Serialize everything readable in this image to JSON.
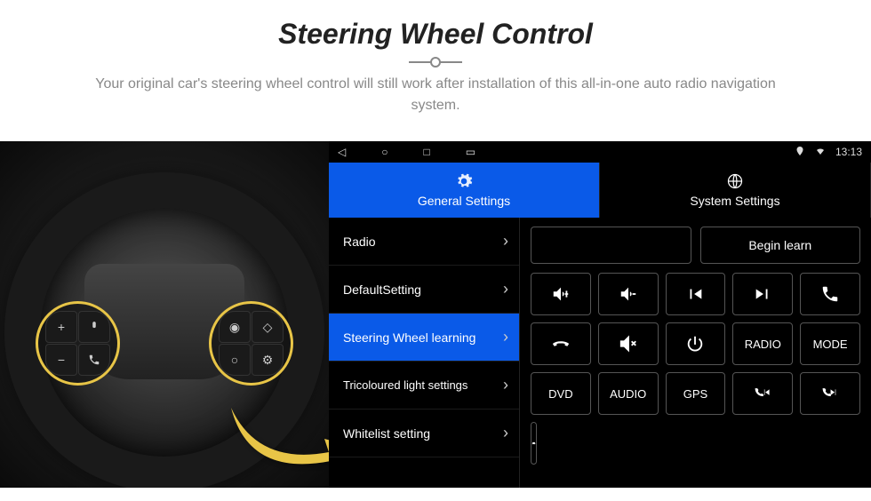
{
  "header": {
    "title": "Steering Wheel Control",
    "subtitle": "Your original car's steering wheel control will still work after installation of this all-in-one auto radio navigation system."
  },
  "wheel": {
    "left_buttons": {
      "tl": "+",
      "tr": "voice",
      "bl": "−",
      "br": "phone"
    },
    "right_buttons": {
      "tl": "disc",
      "tr": "diamond",
      "bl": "circle",
      "br": "gear"
    }
  },
  "statusbar": {
    "nav": {
      "back": "◁",
      "home": "○",
      "recent": "□",
      "apps": "▭"
    },
    "location": "location",
    "wifi": "wifi",
    "time": "13:13"
  },
  "tabs": [
    {
      "id": "general",
      "label": "General Settings",
      "icon": "gear",
      "active": true
    },
    {
      "id": "system",
      "label": "System Settings",
      "icon": "globe",
      "active": false
    }
  ],
  "menu": [
    {
      "id": "radio",
      "label": "Radio",
      "active": false
    },
    {
      "id": "default",
      "label": "DefaultSetting",
      "active": false
    },
    {
      "id": "swl",
      "label": "Steering Wheel learning",
      "active": true
    },
    {
      "id": "tricolour",
      "label": "Tricoloured light settings",
      "active": false,
      "multiline": true
    },
    {
      "id": "whitelist",
      "label": "Whitelist setting",
      "active": false
    }
  ],
  "panel": {
    "empty_slot": "",
    "begin_learn": "Begin learn",
    "buttons": [
      {
        "id": "vol-up",
        "type": "icon",
        "icon": "vol-up"
      },
      {
        "id": "vol-down",
        "type": "icon",
        "icon": "vol-down"
      },
      {
        "id": "prev",
        "type": "icon",
        "icon": "prev"
      },
      {
        "id": "next",
        "type": "icon",
        "icon": "next"
      },
      {
        "id": "phone",
        "type": "icon",
        "icon": "phone"
      },
      {
        "id": "hangup",
        "type": "icon",
        "icon": "hangup"
      },
      {
        "id": "mute",
        "type": "icon",
        "icon": "mute"
      },
      {
        "id": "power",
        "type": "icon",
        "icon": "power"
      },
      {
        "id": "radio",
        "type": "text",
        "label": "RADIO"
      },
      {
        "id": "mode",
        "type": "text",
        "label": "MODE"
      },
      {
        "id": "dvd",
        "type": "text",
        "label": "DVD"
      },
      {
        "id": "audio",
        "type": "text",
        "label": "AUDIO"
      },
      {
        "id": "gps",
        "type": "text",
        "label": "GPS"
      },
      {
        "id": "phone-prev",
        "type": "icon",
        "icon": "phone-prev"
      },
      {
        "id": "phone-next",
        "type": "icon",
        "icon": "phone-next"
      }
    ],
    "last_button": {
      "id": "car",
      "type": "icon",
      "icon": "car"
    }
  }
}
